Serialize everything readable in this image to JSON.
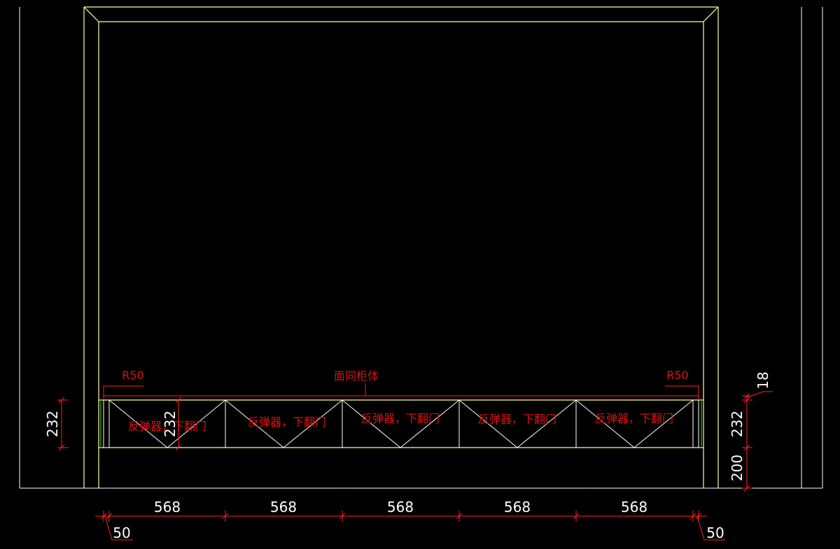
{
  "title_annotation": "面同柜体",
  "radius_left": "R50",
  "radius_right": "R50",
  "door_label": "反弹器，下翻门",
  "door_count": 5,
  "dims": {
    "bottom_widths": [
      "568",
      "568",
      "568",
      "568",
      "568"
    ],
    "left_offset": "50",
    "right_offset": "50",
    "left_height": "232",
    "inner_height": "232",
    "right_top": "18",
    "right_mid": "232",
    "right_bottom": "200"
  },
  "colors": {
    "background": "#000000",
    "outline": "#ffffff",
    "frame": "#ffff99",
    "dimension": "#ff2020",
    "annotation": "#e01010",
    "dim_text": "#ffffff"
  }
}
